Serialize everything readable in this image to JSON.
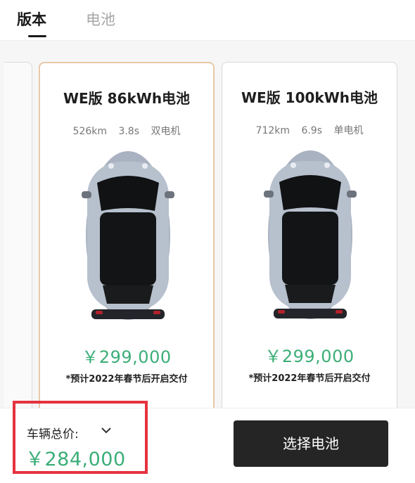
{
  "tabs": [
    {
      "label": "版本"
    },
    {
      "label": "电池"
    }
  ],
  "cards": [
    {
      "title": "WE版 86kWh电池",
      "specs": [
        "526km",
        "3.8s",
        "双电机"
      ],
      "price": "￥299,000",
      "note": "*预计2022年春节后开启交付"
    },
    {
      "title": "WE版 100kWh电池",
      "specs": [
        "712km",
        "6.9s",
        "单电机"
      ],
      "price": "￥299,000",
      "note": "*预计2022年春节后开启交付"
    }
  ],
  "bottom_bar": {
    "total_label": "车辆总价:",
    "total_price": "￥284,000",
    "select_button_label": "选择电池"
  },
  "colors": {
    "price_green": "#3cae78",
    "selected_border": "#e8c8a8",
    "highlight_red": "#e5323f",
    "button_dark": "#252525"
  },
  "icons": {
    "total_expand": "chevron-down-icon"
  }
}
